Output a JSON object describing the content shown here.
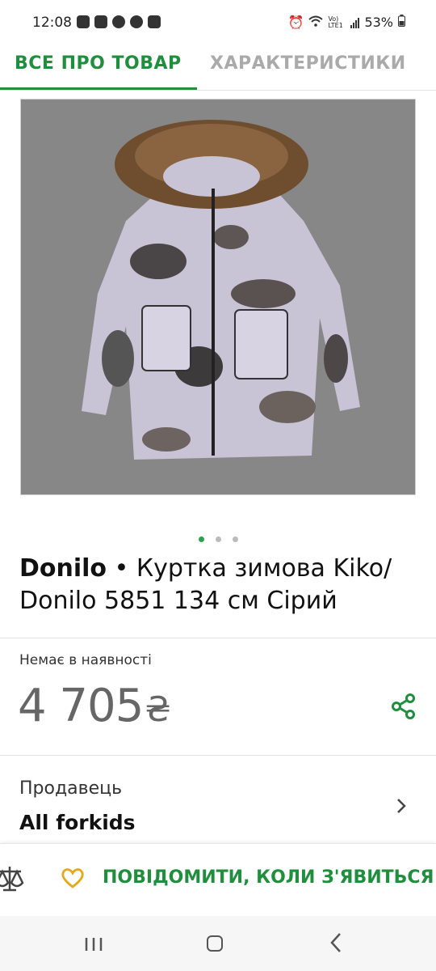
{
  "status_bar": {
    "time": "12:08",
    "notification_icons": [
      "youtube-icon",
      "youtube-icon",
      "emoji-icon",
      "emoji-icon",
      "gallery-icon"
    ],
    "network_label": "Vo) LTE1",
    "battery": "53%"
  },
  "tabs": [
    {
      "label": "ВСЕ ПРО ТОВАР",
      "active": true
    },
    {
      "label": "ХАРАКТЕРИСТИКИ",
      "active": false
    }
  ],
  "product": {
    "image_alt": "jacket-photo",
    "carousel": {
      "count": 3,
      "active": 0
    },
    "brand": "Donilo",
    "title_rest": " • Куртка зимова Kiko/ Donilo 5851 134 см Сірий",
    "availability": "Немає в наявності",
    "price": "4 705",
    "currency": "₴"
  },
  "seller": {
    "label": "Продавець",
    "name": "All forkids"
  },
  "action_bar": {
    "notify_label": "ПОВІДОМИТИ, КОЛИ З'ЯВИТЬСЯ"
  },
  "colors": {
    "accent": "#1f8f3e",
    "dot_active": "#2aa24c",
    "heart": "#e6a817",
    "photo_bg": "#878787"
  }
}
